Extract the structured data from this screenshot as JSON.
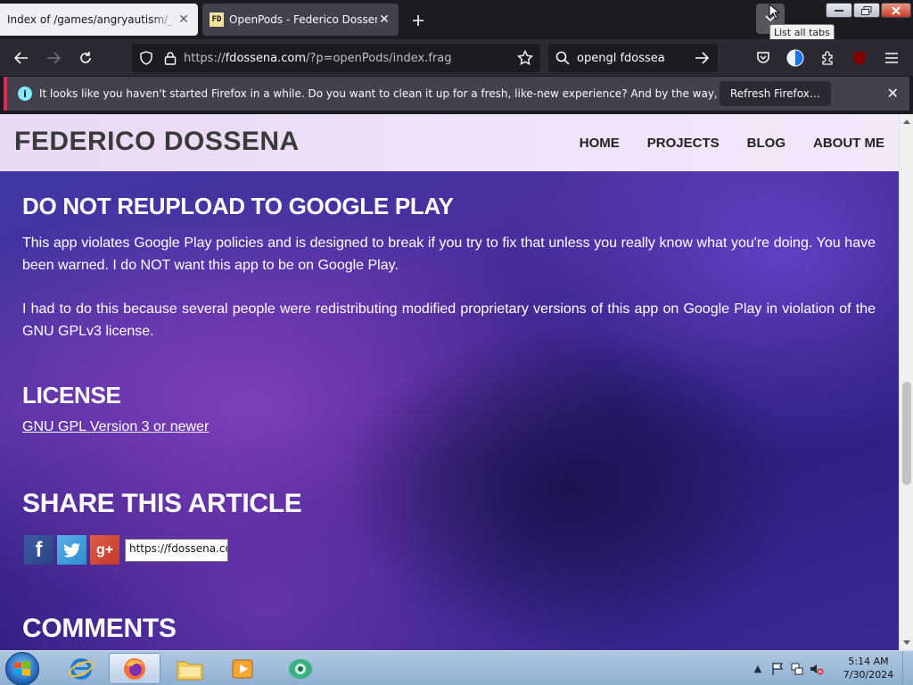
{
  "browser": {
    "tabs": [
      {
        "title": "Index of /games/angryautism/_vanilla",
        "active": false
      },
      {
        "title": "OpenPods - Federico Dossena",
        "active": true,
        "favicon_text": "FD"
      }
    ],
    "list_tabs_tooltip": "List all tabs",
    "url": {
      "prefix": "https://",
      "host": "fdossena.com",
      "path": "/?p=openPods/index.frag"
    },
    "search_text": "opengl fdossea",
    "extension_badge": "uO"
  },
  "notification": {
    "text": "It looks like you haven't started Firefox in a while. Do you want to clean it up for a fresh, like-new experience? And by the way, welcome back!",
    "button": "Refresh Firefox…"
  },
  "site": {
    "logo": "FEDERICO DOSSENA",
    "nav": [
      "HOME",
      "PROJECTS",
      "BLOG",
      "ABOUT ME"
    ]
  },
  "article": {
    "warning_heading": "DO NOT REUPLOAD TO GOOGLE PLAY",
    "warning_p1": "This app violates Google Play policies and is designed to break if you try to fix that unless you really know what you're doing. You have been warned. I do NOT want this app to be on Google Play.",
    "warning_p2": "I had to do this because several people were redistributing modified proprietary versions of this app on Google Play in violation of the GNU GPLv3 license.",
    "license_heading": "LICENSE",
    "license_link": "GNU GPL Version 3 or newer",
    "share_heading": "SHARE THIS ARTICLE",
    "share_url": "https://fdossena.com/?p=openPods/index.frag",
    "comments_heading": "COMMENTS"
  },
  "taskbar": {
    "time": "5:14 AM",
    "date": "7/30/2024"
  },
  "colors": {
    "accent_notification_border": "#e22850",
    "header_bg": "#ead9f5",
    "page_bg": "#3c3aa8"
  }
}
